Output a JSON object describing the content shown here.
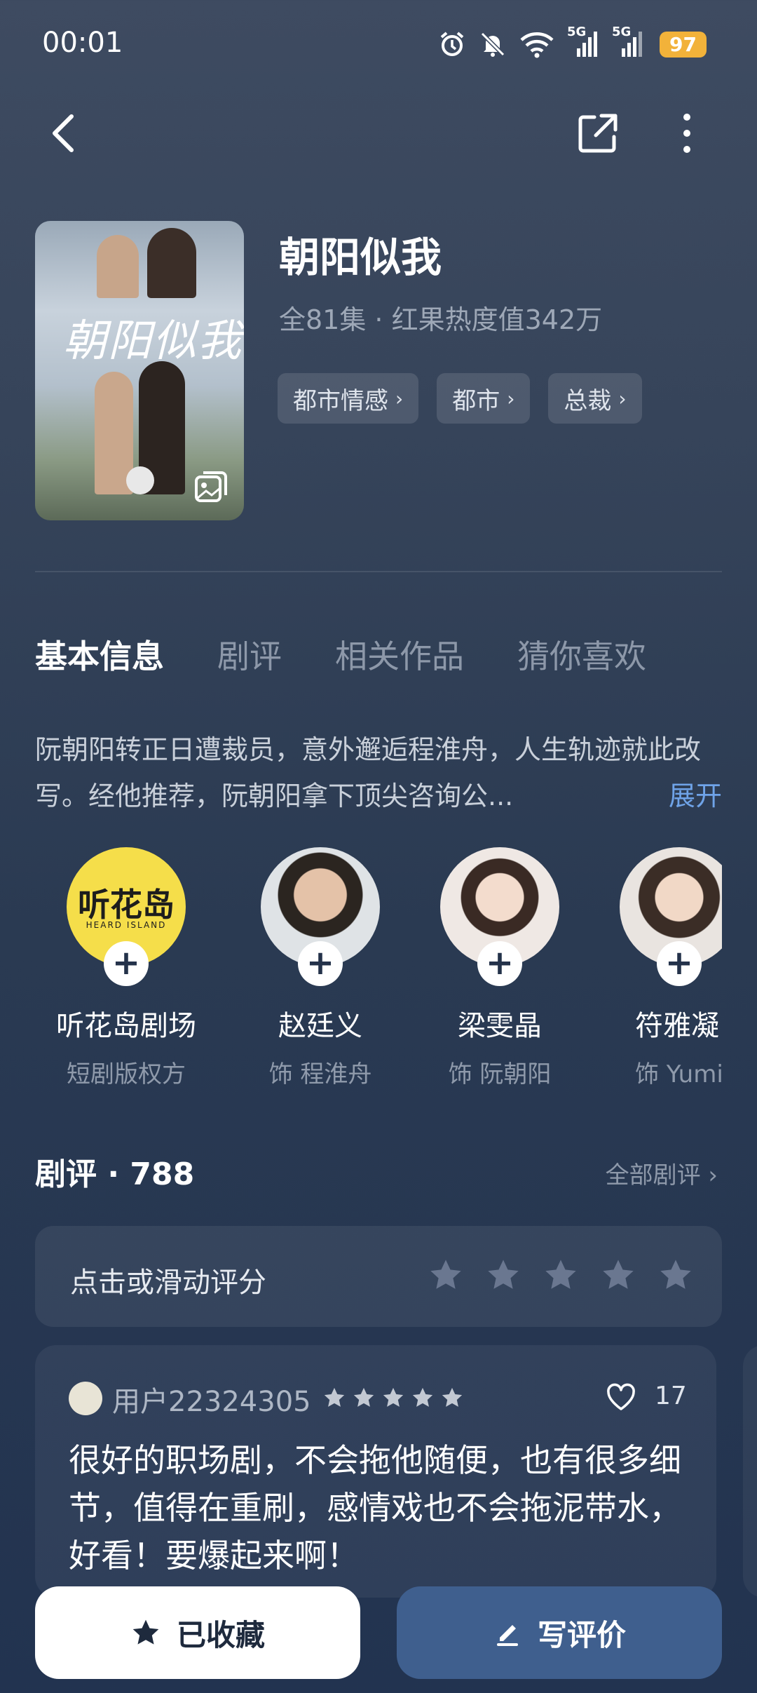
{
  "status_bar": {
    "time": "00:01",
    "network_1": "5G",
    "network_2": "5G",
    "battery": "97",
    "icons": [
      "alarm-icon",
      "mute-icon",
      "wifi-icon",
      "signal-icon",
      "signal-icon",
      "battery-icon"
    ]
  },
  "nav": {
    "back_icon": "back-icon",
    "share_icon": "share-icon",
    "more_icon": "more-icon"
  },
  "drama": {
    "poster_title": "朝阳似我",
    "title": "朝阳似我",
    "meta": "全81集 · 红果热度值342万",
    "tags": [
      "都市情感",
      "都市",
      "总裁"
    ]
  },
  "tabs": [
    "基本信息",
    "剧评",
    "相关作品",
    "猜你喜欢"
  ],
  "active_tab": "基本信息",
  "synopsis": {
    "text": "阮朝阳转正日遭裁员，意外邂逅程淮舟，人生轨迹就此改写。经他推荐，阮朝阳拿下顶尖咨询公...",
    "expand": "展开"
  },
  "cast": [
    {
      "name": "听花岛剧场",
      "role": "短剧版权方",
      "logo_text": "听花岛",
      "logo_sub": "HEARD ISLAND"
    },
    {
      "name": "赵廷义",
      "role": "饰 程淮舟"
    },
    {
      "name": "梁雯晶",
      "role": "饰 阮朝阳"
    },
    {
      "name": "符雅凝",
      "role": "饰 Yumi"
    }
  ],
  "reviews": {
    "title": "剧评 · 788",
    "all_link": "全部剧评",
    "rate_prompt": "点击或滑动评分",
    "rating_max": 5,
    "items": [
      {
        "user": "用户22324305",
        "stars": 5,
        "likes": "17",
        "text": "很好的职场剧，不会拖他随便，也有很多细节，值得在重刷，感情戏也不会拖泥带水，好看！要爆起来啊！"
      }
    ]
  },
  "actions": {
    "collect_label": "已收藏",
    "write_label": "写评价"
  },
  "colors": {
    "accent_link": "#6fa3e8",
    "battery": "#f2b23a",
    "write_button": "#3f5f8e"
  }
}
